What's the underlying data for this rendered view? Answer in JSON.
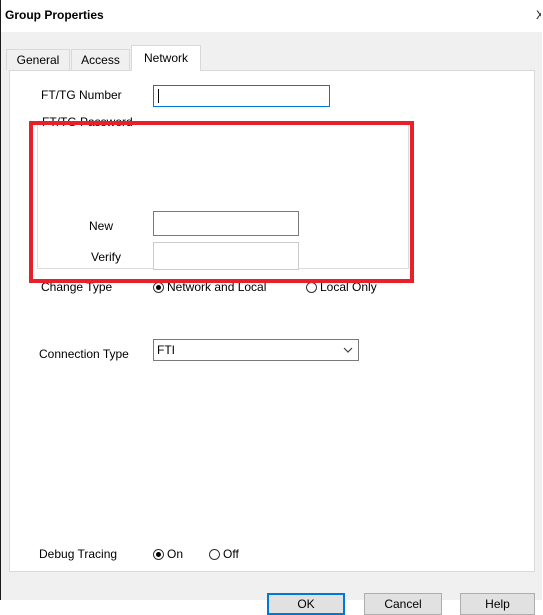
{
  "window": {
    "title": "Group Properties",
    "close_glyph": "X"
  },
  "tabs": [
    {
      "label": "General",
      "active": false
    },
    {
      "label": "Access",
      "active": false
    },
    {
      "label": "Network",
      "active": true
    }
  ],
  "network": {
    "ftg_number_label": "FT/TG Number",
    "ftg_number_value": "",
    "password_group": {
      "legend": "FT/TG Password",
      "new_label": "New",
      "new_value": "",
      "verify_label": "Verify",
      "verify_value": "",
      "change_type_label": "Change Type",
      "change_type_options": [
        "Network and Local",
        "Local Only"
      ],
      "change_type_selected": "Network and Local"
    },
    "connection_type_label": "Connection Type",
    "connection_type_value": "FTI",
    "debug_tracing_label": "Debug Tracing",
    "debug_tracing_options": [
      "On",
      "Off"
    ],
    "debug_tracing_selected": "On"
  },
  "buttons": {
    "ok": "OK",
    "cancel": "Cancel",
    "help": "Help"
  },
  "colors": {
    "highlight": "#e8202a",
    "focus_border": "#0078d7",
    "dialog_bg": "#f0f0f0"
  }
}
